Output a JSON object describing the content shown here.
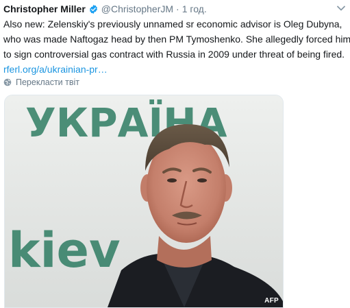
{
  "tweet": {
    "author_name": "Christopher Miller",
    "handle": "@ChristopherJM",
    "separator": "·",
    "time": "1 год.",
    "text_lines": [
      "Also new: Zelenskiy's previously unnamed sr economic advisor is Oleg Dubyna,",
      "who was made Naftogaz head by then PM Tymoshenko. She allegedly forced him",
      "to sign controversial gas contract with Russia in 2009 under threat of being fired."
    ],
    "link_text": "rferl.org/a/ukrainian-pr…",
    "translate_label": "Перекласти твіт"
  },
  "media": {
    "backdrop_letters_top": "УКРАЇНА",
    "backdrop_letters_bottom": "kiev",
    "photo_credit": "AFP"
  },
  "colors": {
    "link": "#1b95e0",
    "verified": "#1da1f2",
    "muted": "#657786",
    "backdrop_text": "#2f7d63"
  },
  "icons": {
    "verified": "verified-badge-icon",
    "caret": "chevron-down-icon",
    "translate": "globe-icon"
  }
}
